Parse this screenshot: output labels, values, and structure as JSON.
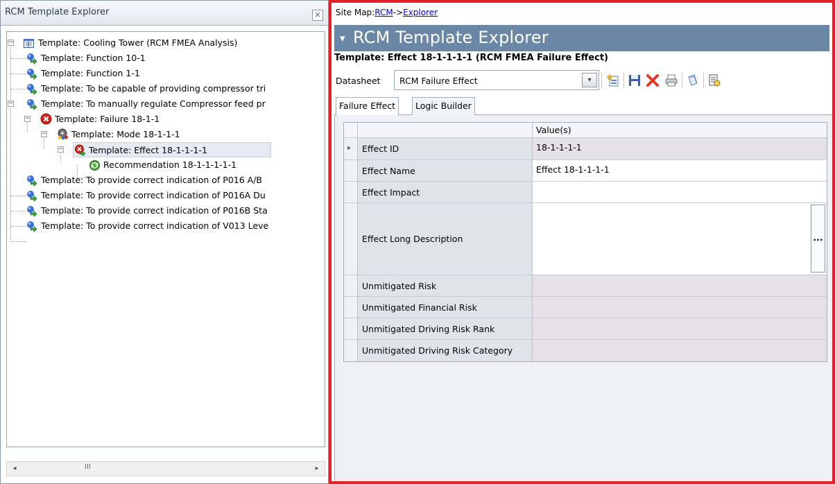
{
  "left_panel": {
    "title": "RCM Template Explorer",
    "close_label": "×",
    "tree": [
      {
        "label": "Template: Cooling Tower (RCM FMEA Analysis)",
        "icon": "analysis-icon"
      },
      {
        "label": "Template: Function 10-1",
        "icon": "function-icon"
      },
      {
        "label": "Template: Function 1-1",
        "icon": "function-icon"
      },
      {
        "label": "Template: To be capable of providing compressor tri",
        "icon": "function-icon"
      },
      {
        "label": "Template: To manually regulate Compressor feed pr",
        "icon": "function-icon"
      },
      {
        "label": "Template: Failure 18-1-1",
        "icon": "failure-icon"
      },
      {
        "label": "Template: Mode 18-1-1-1",
        "icon": "mode-icon"
      },
      {
        "label": "Template: Effect 18-1-1-1-1",
        "icon": "effect-icon"
      },
      {
        "label": "Recommendation 18-1-1-1-1-1",
        "icon": "recommendation-icon"
      },
      {
        "label": "Template: To provide correct indication of P016 A/B",
        "icon": "function-icon"
      },
      {
        "label": "Template: To provide correct indication of P016A Du",
        "icon": "function-icon"
      },
      {
        "label": "Template: To provide correct indication of P016B Sta",
        "icon": "function-icon"
      },
      {
        "label": "Template: To provide correct indication of V013 Leve",
        "icon": "function-icon"
      }
    ],
    "scroll_left": "◂",
    "scroll_right": "▸",
    "scroll_grip": "III"
  },
  "right_panel": {
    "sitemap_prefix": "Site Map:",
    "sitemap_link1": "RCM",
    "sitemap_sep": "->",
    "sitemap_link2": "Explorer",
    "banner_caret": "▾",
    "banner_title": "RCM Template Explorer",
    "record_title": "Template: Effect 18-1-1-1-1 (RCM FMEA Failure Effect)",
    "datasheet_label": "Datasheet",
    "datasheet_value": "RCM Failure Effect",
    "datasheet_dropdown": "▾",
    "tabs": [
      "Failure Effect",
      "Logic Builder"
    ],
    "grid": {
      "header_value": "Value(s)",
      "current_row_marker": "▸",
      "more_button": "...",
      "rows": [
        {
          "label": "Effect ID",
          "value": "18-1-1-1-1"
        },
        {
          "label": "Effect Name",
          "value": "Effect 18-1-1-1-1"
        },
        {
          "label": "Effect Impact",
          "value": ""
        },
        {
          "label": "Effect Long Description",
          "value": ""
        },
        {
          "label": "Unmitigated Risk",
          "value": ""
        },
        {
          "label": "Unmitigated Financial Risk",
          "value": ""
        },
        {
          "label": "Unmitigated Driving Risk Rank",
          "value": ""
        },
        {
          "label": "Unmitigated Driving Risk Category",
          "value": ""
        }
      ]
    }
  },
  "colors": {
    "highlight_border": "#e4212a",
    "banner": "#6a87a5",
    "delete_icon": "#e8361f",
    "save_icon": "#3d5fa8"
  }
}
